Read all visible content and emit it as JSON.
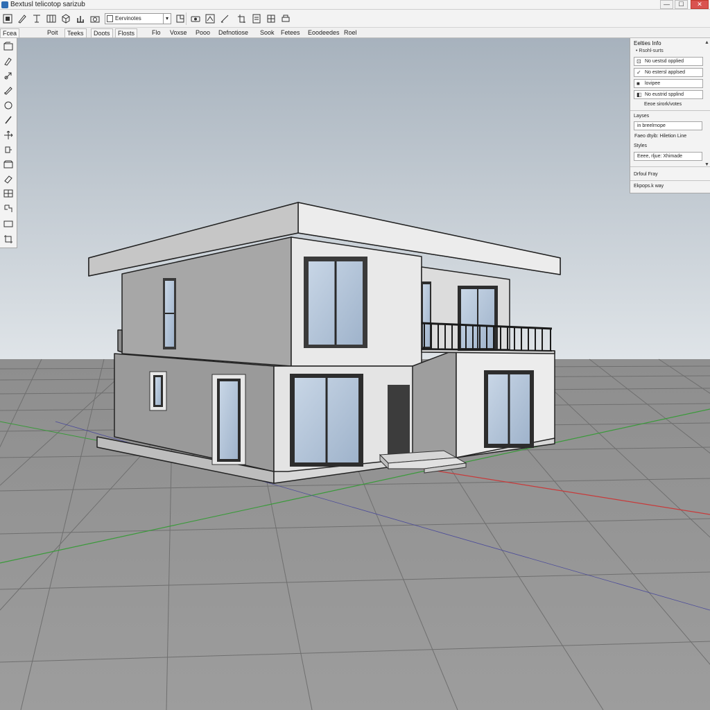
{
  "window": {
    "title": "Bextusl telicotop sarizub",
    "minimize_symbol": "—",
    "maximize_symbol": "☐",
    "close_symbol": "✕"
  },
  "toolbar": {
    "select_value": "Eervinotes",
    "select_arrow": "▾",
    "icons": [
      "select-icon",
      "pencil-icon",
      "tape-measure-icon",
      "wall-icon",
      "box-icon",
      "chart-icon",
      "camera-icon",
      "stamp-icon",
      "eraser-icon",
      "draw-line-icon",
      "clipboard-icon",
      "document-icon",
      "grid-icon"
    ]
  },
  "menu": {
    "items": [
      {
        "label": "Fcea",
        "boxed": true
      },
      {
        "label": "Poit",
        "boxed": false
      },
      {
        "label": "Teeks",
        "boxed": true
      },
      {
        "label": "Doots",
        "boxed": true
      },
      {
        "label": "Flosts",
        "boxed": true
      },
      {
        "label": "Flo",
        "boxed": false
      },
      {
        "label": "Voxse",
        "boxed": false
      },
      {
        "label": "Pooo",
        "boxed": false
      },
      {
        "label": "Defnotiose",
        "boxed": false
      },
      {
        "label": "Sook",
        "boxed": false
      },
      {
        "label": "Fetees",
        "boxed": false
      },
      {
        "label": "Eoodeedes",
        "boxed": false
      },
      {
        "label": "Roel",
        "boxed": false
      }
    ]
  },
  "left_tools": [
    {
      "name": "select-tool",
      "glyph": "▭"
    },
    {
      "name": "paint-tool",
      "glyph": "✎"
    },
    {
      "name": "push-pull-tool",
      "glyph": "⇲"
    },
    {
      "name": "pencil-tool",
      "glyph": "✐"
    },
    {
      "name": "circle-tool",
      "glyph": "○"
    },
    {
      "name": "line-tool",
      "glyph": "/"
    },
    {
      "name": "move-tool",
      "glyph": "✥"
    },
    {
      "name": "rotate-tool",
      "glyph": "↻"
    },
    {
      "name": "offset-tool",
      "glyph": "⧉"
    },
    {
      "name": "eraser-tool",
      "glyph": "⌫"
    },
    {
      "name": "scale-tool",
      "glyph": "⊞"
    },
    {
      "name": "follow-me-tool",
      "glyph": "⊹"
    },
    {
      "name": "rectangle-tool",
      "glyph": "□"
    },
    {
      "name": "section-tool",
      "glyph": "⊏"
    }
  ],
  "entity_info": {
    "title": "Eelties Info",
    "subtitle": "• Rsohl-surts",
    "materials": [
      {
        "icon": "paint-icon",
        "glyph": "⊡",
        "label": "No uestsd opplied"
      },
      {
        "icon": "brush-icon",
        "glyph": "✓",
        "label": "No estersl applsed"
      },
      {
        "icon": "cube-icon",
        "glyph": "■",
        "label": "lovipee"
      },
      {
        "icon": "layer-icon",
        "glyph": "◧",
        "label": "No eustrid spplind"
      }
    ],
    "note": "Eeoe sirork/votes",
    "layers_label": "Layses",
    "layer_value": "in breelrnope",
    "face_style": "Faeo dtyib: Hiletion Line",
    "styles_label": "Styles",
    "style_value": "Eeee, rljue: Xhimade",
    "default_tray": "Drfoul Fray",
    "display_way": "Ekpops.k way",
    "scroll_up": "▲",
    "scroll_down": "▼"
  }
}
